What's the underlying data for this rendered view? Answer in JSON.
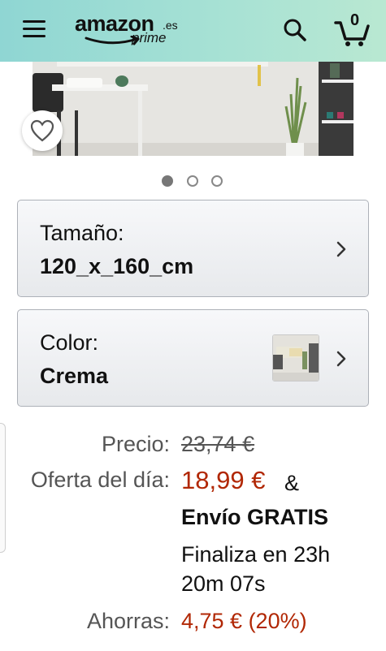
{
  "header": {
    "menu_icon": "hamburger-menu-icon",
    "logo_text": "amazon",
    "logo_tld": ".es",
    "logo_sub": "prime",
    "search_icon": "search-icon",
    "cart_icon": "cart-icon",
    "cart_count": "0",
    "colors": {
      "bg_start": "#8fd6d3",
      "bg_end": "#b9e8d2"
    }
  },
  "product": {
    "image_alt": "room-scene",
    "wishlist_icon": "heart-icon",
    "carousel": {
      "count": 3,
      "active_index": 0
    }
  },
  "options": {
    "size": {
      "label": "Tamaño:",
      "value": "120_x_160_cm"
    },
    "color": {
      "label": "Color:",
      "value": "Crema"
    }
  },
  "pricing": {
    "list_label": "Precio:",
    "list_price": "23,74 €",
    "deal_label": "Oferta del día:",
    "deal_price": "18,99 €",
    "ampersand": "&",
    "shipping": "Envío GRATIS",
    "ends_line1": "Finaliza en 23h",
    "ends_line2": "20m 07s",
    "savings_label": "Ahorras:",
    "savings_value": "4,75 € (20%)",
    "accent_color": "#b12704"
  }
}
